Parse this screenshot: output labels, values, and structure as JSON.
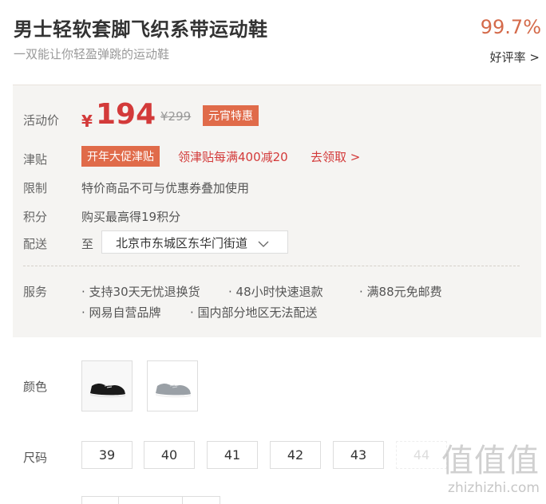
{
  "product": {
    "title": "男士轻软套脚飞织系带运动鞋",
    "subtitle": "一双能让你轻盈弹跳的运动鞋",
    "rating": "99.7%",
    "rating_link": "好评率 >"
  },
  "promo": {
    "price_label": "活动价",
    "currency": "¥",
    "price": "194",
    "original_price": "¥299",
    "badge": "元宵特惠",
    "allowance_label": "津贴",
    "allowance_tag": "开年大促津贴",
    "allowance_text": "领津贴每满400减20",
    "allowance_link": "去领取 >",
    "limit_label": "限制",
    "limit_text": "特价商品不可与优惠券叠加使用",
    "points_label": "积分",
    "points_text": "购买最高得19积分",
    "delivery_label": "配送",
    "delivery_to": "至",
    "address": "北京市东城区东华门街道",
    "service_label": "服务",
    "services": [
      "· 支持30天无忧退换货",
      "· 48小时快速退款",
      "· 满88元免邮费",
      "· 网易自营品牌",
      "· 国内部分地区无法配送"
    ]
  },
  "options": {
    "color_label": "颜色",
    "colors": [
      {
        "name": "black-shoe-icon",
        "accent": "#1a1a1a"
      },
      {
        "name": "gray-shoe-icon",
        "accent": "#9aa0a6"
      }
    ],
    "size_label": "尺码",
    "sizes": [
      "39",
      "40",
      "41",
      "42",
      "43",
      "44"
    ]
  },
  "watermark": {
    "big": "值值值",
    "small": "zhizhizhi.com"
  }
}
